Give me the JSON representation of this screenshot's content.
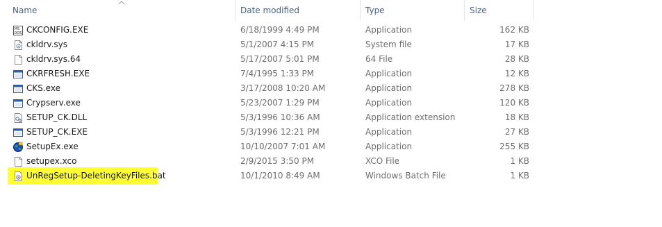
{
  "columns": {
    "name": "Name",
    "date": "Date modified",
    "type": "Type",
    "size": "Size"
  },
  "sort": {
    "column": "name",
    "direction": "ascending"
  },
  "files": [
    {
      "name": "CKCONFIG.EXE",
      "date": "6/18/1999 4:49 PM",
      "type": "Application",
      "size": "162 KB",
      "icon": "ms-dos-app-icon"
    },
    {
      "name": "ckldrv.sys",
      "date": "5/1/2007 4:15 PM",
      "type": "System file",
      "size": "17 KB",
      "icon": "system-file-icon"
    },
    {
      "name": "ckldrv.sys.64",
      "date": "5/17/2007 5:01 PM",
      "type": "64 File",
      "size": "28 KB",
      "icon": "blank-file-icon"
    },
    {
      "name": "CKRFRESH.EXE",
      "date": "7/4/1995 1:33 PM",
      "type": "Application",
      "size": "12 KB",
      "icon": "window-app-icon"
    },
    {
      "name": "CKS.exe",
      "date": "3/17/2008 10:20 AM",
      "type": "Application",
      "size": "278 KB",
      "icon": "window-app-icon"
    },
    {
      "name": "Crypserv.exe",
      "date": "5/23/2007 1:29 PM",
      "type": "Application",
      "size": "120 KB",
      "icon": "window-app-icon"
    },
    {
      "name": "SETUP_CK.DLL",
      "date": "5/3/1996 10:36 AM",
      "type": "Application extension",
      "size": "18 KB",
      "icon": "dll-file-icon"
    },
    {
      "name": "SETUP_CK.EXE",
      "date": "5/3/1996 12:21 PM",
      "type": "Application",
      "size": "27 KB",
      "icon": "window-app-icon"
    },
    {
      "name": "SetupEx.exe",
      "date": "10/10/2007 7:01 AM",
      "type": "Application",
      "size": "255 KB",
      "icon": "globe-setup-icon"
    },
    {
      "name": "setupex.xco",
      "date": "2/9/2015 3:50 PM",
      "type": "XCO File",
      "size": "1 KB",
      "icon": "blank-file-icon"
    },
    {
      "name": "UnRegSetup-DeletingKeyFiles.bat",
      "date": "10/1/2010 8:49 AM",
      "type": "Windows Batch File",
      "size": "1 KB",
      "icon": "batch-file-icon",
      "highlighted": true
    }
  ],
  "colors": {
    "header_text": "#4c607a",
    "detail_text": "#6d6d6d",
    "highlight": "#ffff33"
  }
}
